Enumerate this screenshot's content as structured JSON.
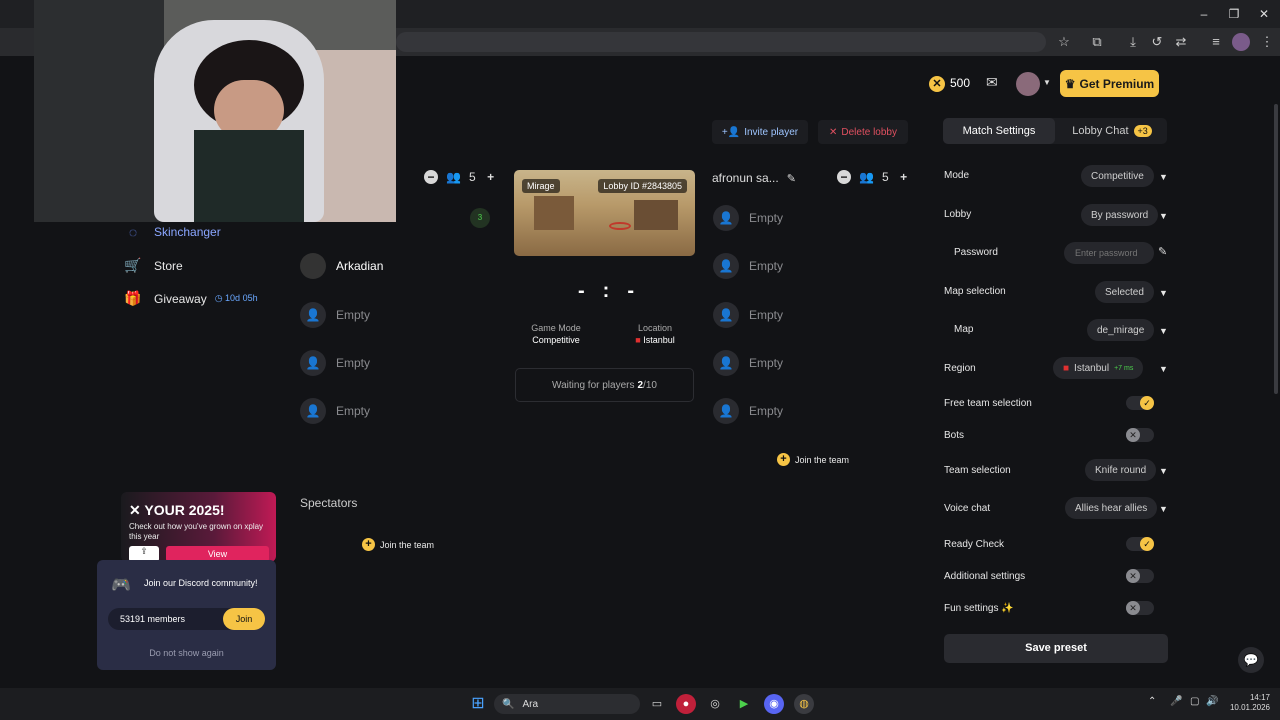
{
  "browser": {
    "controls": [
      "–",
      "❐",
      "✕"
    ]
  },
  "header": {
    "coins": "500",
    "premium_label": "Get Premium"
  },
  "sidebar": {
    "items": [
      {
        "label": "Skinchanger",
        "icon": "skinchanger-icon"
      },
      {
        "label": "Store",
        "icon": "cart-icon"
      },
      {
        "label": "Giveaway",
        "icon": "gift-icon",
        "timer": "10d 05h"
      }
    ]
  },
  "promo": {
    "title": "YOUR 2025!",
    "text": "Check out how you've grown on xplay this year",
    "view_label": "View"
  },
  "discord": {
    "title": "Join our Discord community!",
    "members": "53191 members",
    "join_label": "Join",
    "dismiss": "Do not show again"
  },
  "lobby": {
    "invite_label": "Invite player",
    "delete_label": "Delete lobby",
    "team_left": {
      "size": "5",
      "players": [
        "",
        "Arkadian",
        "Empty",
        "Empty",
        "Empty"
      ],
      "badge": "3"
    },
    "team_right": {
      "name": "afronun sa...",
      "size": "5",
      "players": [
        "Empty",
        "Empty",
        "Empty",
        "Empty",
        "Empty"
      ],
      "join_label": "Join the team"
    },
    "map_name": "Mirage",
    "lobby_id": "Lobby ID #2843805",
    "score_left": "-",
    "score_sep": ":",
    "score_right": "-",
    "game_mode_label": "Game Mode",
    "game_mode": "Competitive",
    "location_label": "Location",
    "location": "Istanbul",
    "waiting_prefix": "Waiting for players",
    "waiting_count": "2",
    "waiting_total": "/10",
    "spectators_label": "Spectators",
    "spectators_join": "Join the team"
  },
  "settings": {
    "tab_active": "Match Settings",
    "tab_other": "Lobby Chat",
    "chat_badge": "+3",
    "rows": {
      "mode": {
        "label": "Mode",
        "value": "Competitive"
      },
      "lobby": {
        "label": "Lobby",
        "value": "By password"
      },
      "password": {
        "label": "Password",
        "placeholder": "Enter password"
      },
      "map_selection": {
        "label": "Map selection",
        "value": "Selected"
      },
      "map": {
        "label": "Map",
        "value": "de_mirage"
      },
      "region": {
        "label": "Region",
        "value": "Istanbul",
        "ping": "+7 ms"
      },
      "free_team": {
        "label": "Free team selection",
        "on": true
      },
      "bots": {
        "label": "Bots",
        "on": false
      },
      "team_selection": {
        "label": "Team selection",
        "value": "Knife round"
      },
      "voice_chat": {
        "label": "Voice chat",
        "value": "Allies hear allies"
      },
      "ready_check": {
        "label": "Ready Check",
        "on": true
      },
      "additional": {
        "label": "Additional settings",
        "on": false
      },
      "fun": {
        "label": "Fun settings",
        "on": false
      }
    },
    "save_label": "Save preset"
  },
  "taskbar": {
    "search_label": "Ara",
    "time": "14:17",
    "date": "10.01.2026"
  },
  "colors": {
    "accent": "#f6c445",
    "danger": "#e05060",
    "link": "#6aa8ff"
  }
}
